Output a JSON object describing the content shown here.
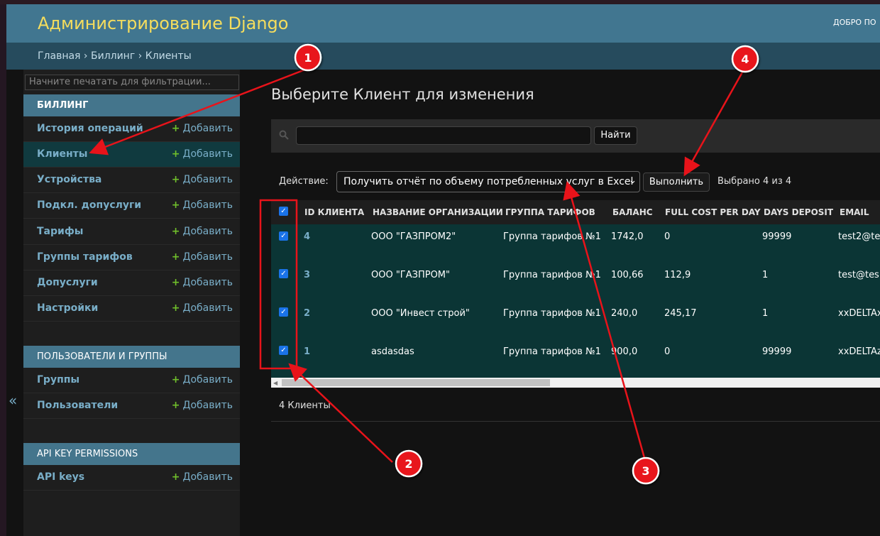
{
  "header": {
    "site_title": "Администрирование Django",
    "user_tools": "ДОБРО ПО"
  },
  "breadcrumbs": {
    "home": "Главная",
    "app": "Биллинг",
    "current": "Клиенты",
    "sep": " › "
  },
  "sidebar": {
    "filter_placeholder": "Начните печатать для фильтрации...",
    "collapse_glyph": "«",
    "modules": [
      {
        "caption": "БИЛЛИНГ",
        "items": [
          {
            "label": "История операций",
            "add": "Добавить"
          },
          {
            "label": "Клиенты",
            "add": "Добавить"
          },
          {
            "label": "Устройства",
            "add": "Добавить"
          },
          {
            "label": "Подкл. допуслуги",
            "add": "Добавить"
          },
          {
            "label": "Тарифы",
            "add": "Добавить"
          },
          {
            "label": "Группы тарифов",
            "add": "Добавить"
          },
          {
            "label": "Допуслуги",
            "add": "Добавить"
          },
          {
            "label": "Настройки",
            "add": "Добавить"
          }
        ]
      },
      {
        "caption": "ПОЛЬЗОВАТЕЛИ И ГРУППЫ",
        "items": [
          {
            "label": "Группы",
            "add": "Добавить"
          },
          {
            "label": "Пользователи",
            "add": "Добавить"
          }
        ]
      },
      {
        "caption": "API KEY PERMISSIONS",
        "items": [
          {
            "label": "API keys",
            "add": "Добавить"
          }
        ]
      }
    ],
    "plus": "+"
  },
  "main": {
    "title": "Выберите Клиент для изменения",
    "search_button": "Найти",
    "action_label": "Действие:",
    "action_selected": "Получить отчёт по объему потребленных услуг в Excel",
    "run_button": "Выполнить",
    "counter": "Выбрано 4 из 4",
    "table": {
      "columns": [
        "ID КЛИЕНТА",
        "НАЗВАНИЕ ОРГАНИЗАЦИИ",
        "ГРУППА ТАРИФОВ",
        "БАЛАНС",
        "FULL COST PER DAY",
        "DAYS DEPOSIT",
        "EMAIL"
      ],
      "rows": [
        [
          "4",
          "ООО \"ГАЗПРОМ2\"",
          "Группа тарифов №1",
          "1742,0",
          "0",
          "99999",
          "test2@te"
        ],
        [
          "3",
          "ООО \"ГАЗПРОМ\"",
          "Группа тарифов №1",
          "100,66",
          "112,9",
          "1",
          "test@tes"
        ],
        [
          "2",
          "ООО \"Инвест строй\"",
          "Группа тарифов №1",
          "240,0",
          "245,17",
          "1",
          "xxDELTAx"
        ],
        [
          "1",
          "asdasdas",
          "Группа тарифов №1",
          "900,0",
          "0",
          "99999",
          "xxDELTAz"
        ]
      ]
    },
    "paginator": "4 Клиенты"
  },
  "annotations": {
    "markers": [
      "1",
      "2",
      "3",
      "4"
    ],
    "color": "#e8131a"
  }
}
